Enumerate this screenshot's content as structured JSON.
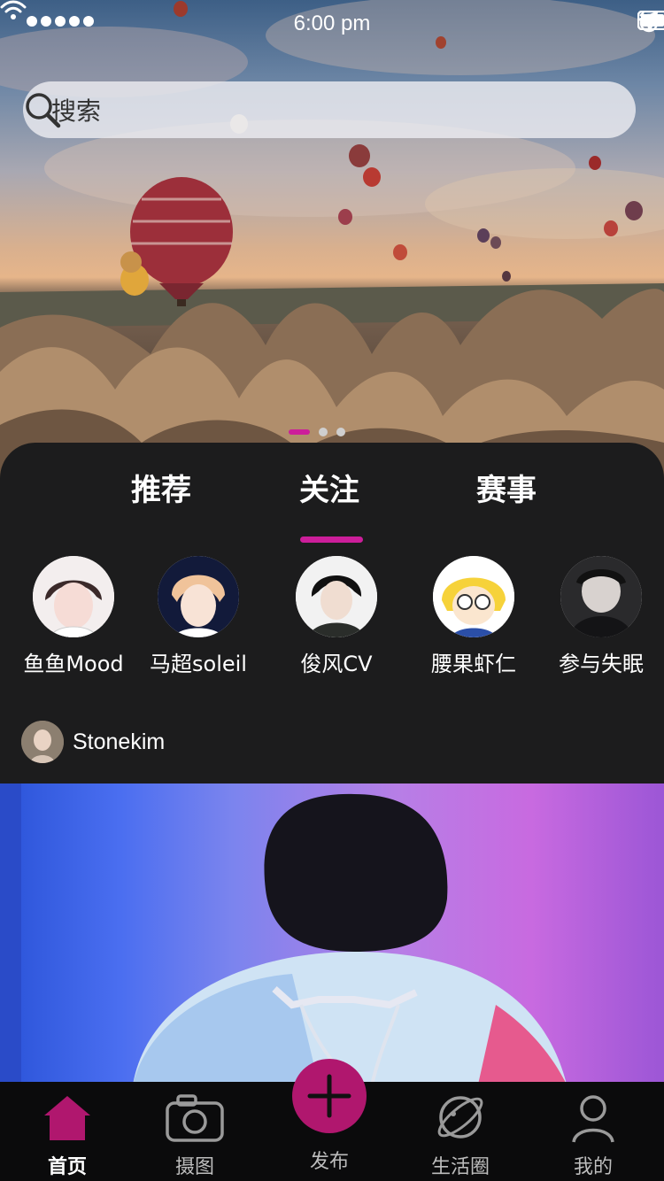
{
  "status_bar": {
    "time": "6:00 pm"
  },
  "search": {
    "placeholder": "搜索"
  },
  "banner": {
    "active_index": 0,
    "count": 3
  },
  "tabs": [
    {
      "label": "推荐"
    },
    {
      "label": "关注",
      "active": true
    },
    {
      "label": "赛事"
    }
  ],
  "following": [
    {
      "name": "鱼鱼Mood"
    },
    {
      "name": "马超soleil"
    },
    {
      "name": "俊风CV"
    },
    {
      "name": "腰果虾仁"
    },
    {
      "name": "参与失眠"
    }
  ],
  "post": {
    "author": "Stonekim"
  },
  "tabbar": {
    "home": "首页",
    "camera": "摄图",
    "publish": "发布",
    "life": "生活圈",
    "mine": "我的"
  },
  "colors": {
    "accent": "#cc1e9a",
    "fab": "#b0176e",
    "panel": "#1c1c1d"
  }
}
